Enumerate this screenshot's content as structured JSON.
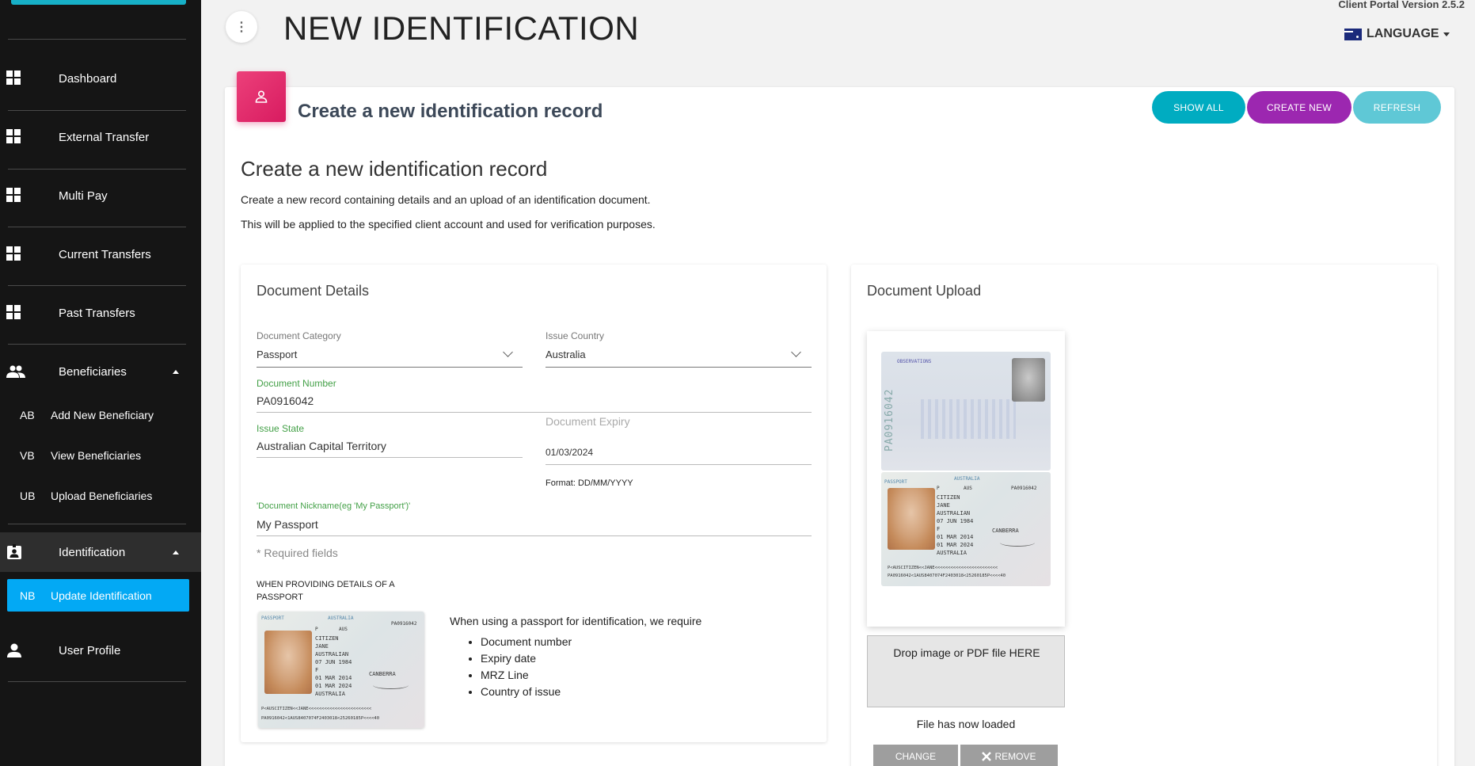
{
  "app": {
    "version_text": "Client Portal Version 2.5.2",
    "language_label": "LANGUAGE",
    "page_title": "NEW IDENTIFICATION",
    "menu_glyph": "⋮"
  },
  "sidebar": {
    "items": [
      {
        "label": "Dashboard",
        "icon": "dashboard-icon"
      },
      {
        "label": "External Transfer",
        "icon": "dashboard-icon"
      },
      {
        "label": "Multi Pay",
        "icon": "dashboard-icon"
      },
      {
        "label": "Current Transfers",
        "icon": "dashboard-icon"
      },
      {
        "label": "Past Transfers",
        "icon": "dashboard-icon"
      },
      {
        "label": "Beneficiaries",
        "icon": "people-icon"
      }
    ],
    "beneficiaries_sub": [
      {
        "abbr": "AB",
        "label": "Add New Beneficiary"
      },
      {
        "abbr": "VB",
        "label": "View Beneficiaries"
      },
      {
        "abbr": "UB",
        "label": "Upload Beneficiaries"
      }
    ],
    "identification": {
      "label": "Identification",
      "icon": "id-badge-icon"
    },
    "identification_sub": [
      {
        "abbr": "NB",
        "label": "Update Identification"
      }
    ],
    "user_profile": {
      "label": "User Profile",
      "icon": "person-icon"
    }
  },
  "card": {
    "title": "Create a new identification record",
    "buttons": {
      "show_all": "SHOW ALL",
      "create_new": "CREATE NEW",
      "refresh": "REFRESH"
    },
    "section_title": "Create a new identification record",
    "para1": "Create a new record containing details and an upload of an identification document.",
    "para2": "This will be applied to the specified client account and used for verification purposes."
  },
  "details": {
    "title": "Document Details",
    "category_label": "Document Category",
    "category_value": "Passport",
    "country_label": "Issue Country",
    "country_value": "Australia",
    "number_label": "Document Number",
    "number_value": "PA0916042",
    "expiry_label": "Document Expiry",
    "expiry_value": "01/03/2024",
    "expiry_format": "Format: DD/MM/YYYY",
    "state_label": "Issue State",
    "state_value": "Australian Capital Territory",
    "nickname_label": "'Document Nickname(eg 'My Passport')'",
    "nickname_value": "My Passport",
    "required_note": "* Required fields",
    "passport_heading_1": "WHEN PROVIDING DETAILS OF A",
    "passport_heading_2": "PASSPORT",
    "requirement_intro": "When using a passport for identification, we require",
    "requirements": [
      "Document number",
      "Expiry date",
      "MRZ Line",
      "Country of issue"
    ]
  },
  "passport_image": {
    "doc_type": "PASSPORT",
    "code": "P",
    "country_code": "AUS",
    "country": "AUSTRALIA",
    "number": "PA0916042",
    "surname": "CITIZEN",
    "given_name": "JANE",
    "nationality": "AUSTRALIAN",
    "dob": "07 JUN 1984",
    "sex": "F",
    "issued": "01 MAR 2014",
    "expiry": "01 MAR 2024",
    "place": "CANBERRA",
    "country_footer": "AUSTRALIA",
    "mrz1": "P<AUSCITIZEN<<JANE<<<<<<<<<<<<<<<<<<<<<<<<",
    "mrz2": "PA0916042<1AUS8407074F2403018<25260185P<<<<40",
    "vertical_number": "PA0916042",
    "observations": "OBSERVATIONS"
  },
  "upload": {
    "title": "Document Upload",
    "drop_label": "Drop image or PDF file HERE",
    "loaded_label": "File has now loaded",
    "change_label": "CHANGE",
    "remove_label": "REMOVE"
  },
  "colors": {
    "sidebar_bg": "#151515",
    "active_item": "#03a9f4",
    "show_all": "#00acc1",
    "create_new": "#9c27b0",
    "refresh": "#5fc8d6",
    "card_icon": "#e91e63",
    "green_label": "#43a047"
  }
}
